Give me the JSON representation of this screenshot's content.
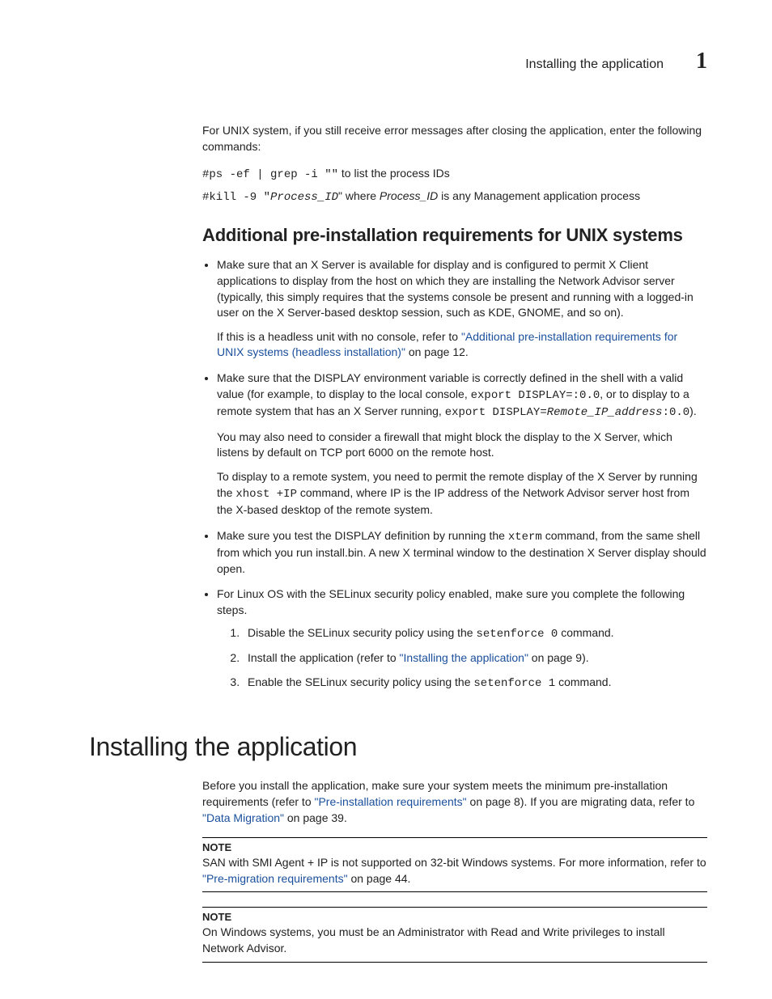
{
  "header": {
    "running_title": "Installing the application",
    "chapter_number": "1"
  },
  "intro": {
    "para1": "For UNIX system, if you still receive error messages after closing the application, enter the following commands:",
    "cmd1_code": "#ps -ef | grep -i \"\"",
    "cmd1_suffix": " to list the process IDs",
    "cmd2_prefix": "#kill -9 \"",
    "cmd2_italic": "Process_ID",
    "cmd2_mid": "\" where ",
    "cmd2_italic2": "Process_ID",
    "cmd2_suffix": " is any Management application process"
  },
  "section1": {
    "heading": "Additional pre-installation requirements for UNIX systems",
    "b1": {
      "p1": "Make sure that an X Server is available for display and is configured to permit X Client applications to display from the host on which they are installing the Network Advisor server (typically, this simply requires that the systems console be present and running with a logged-in user on the X Server-based desktop session, such as KDE, GNOME, and so on).",
      "p2_pre": "If this is a headless unit with no console, refer to ",
      "p2_link": "\"Additional pre-installation requirements for UNIX systems  (headless installation)\"",
      "p2_post": " on page 12."
    },
    "b2": {
      "p1_pre": "Make sure that the DISPLAY environment variable is correctly defined in the shell with a valid value (for example, to display to the local console, ",
      "p1_code1": "export DISPLAY=:0.0",
      "p1_mid": ", or to display to a remote system that has an X Server running, ",
      "p1_code2": "export DISPLAY=",
      "p1_italic": "Remote_IP_address",
      "p1_code3": ":0.0",
      "p1_end": ").",
      "p2": "You may also need to consider a firewall that might block the display to the X Server, which listens by default on TCP port 6000 on the remote host.",
      "p3_pre": "To display to a remote system, you need to permit the remote display of the X Server by running the ",
      "p3_code": "xhost +IP",
      "p3_post": " command, where IP is the IP address of the Network Advisor server host from the X-based desktop of the remote system."
    },
    "b3": {
      "p1_pre": "Make sure you test the DISPLAY definition by running the ",
      "p1_code": "xterm",
      "p1_post": " command, from the same shell from which you run install.bin. A new X terminal window to the destination X Server display should open."
    },
    "b4": {
      "p1": "For Linux OS with the SELinux security policy enabled, make sure you complete the following steps.",
      "s1_pre": "Disable the SELinux security policy using the ",
      "s1_code": "setenforce 0",
      "s1_post": " command.",
      "s2_pre": "Install the application (refer to ",
      "s2_link": "\"Installing the application\"",
      "s2_post": " on page 9).",
      "s3_pre": "Enable the SELinux security policy using the ",
      "s3_code": "setenforce 1",
      "s3_post": " command."
    }
  },
  "section2": {
    "heading": "Installing the application",
    "p1_pre": "Before you install the application, make sure your system meets the minimum pre-installation requirements (refer to ",
    "p1_link1": "\"Pre-installation requirements\"",
    "p1_mid": " on page 8). If you are migrating data, refer to ",
    "p1_link2": "\"Data Migration\"",
    "p1_post": " on page 39.",
    "note1": {
      "label": "NOTE",
      "text_pre": "SAN with SMI Agent + IP is not supported on 32-bit Windows systems. For more information, refer to ",
      "text_link": "\"Pre-migration requirements\"",
      "text_post": " on page 44."
    },
    "note2": {
      "label": "NOTE",
      "text": "On Windows systems, you must be an Administrator with Read and Write privileges to install Network Advisor."
    }
  }
}
